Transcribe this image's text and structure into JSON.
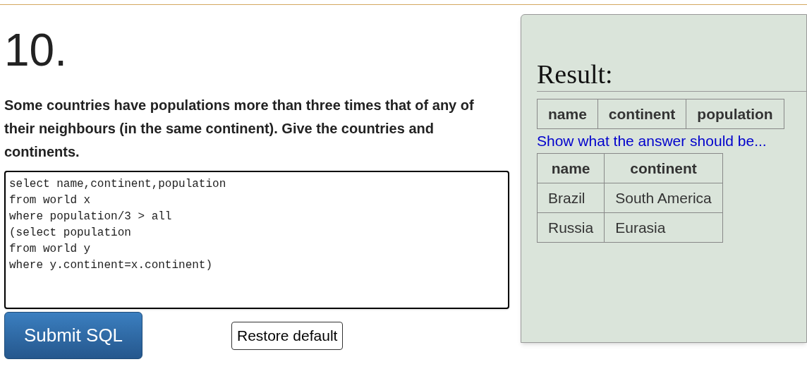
{
  "question": {
    "number": "10.",
    "text": "Some countries have populations more than three times that of any of their neighbours (in the same continent). Give the countries and continents."
  },
  "editor": {
    "value": "select name,continent,population\nfrom world x\nwhere population/3 > all\n(select population\nfrom world y\nwhere y.continent=x.continent)"
  },
  "buttons": {
    "submit": "Submit SQL",
    "restore": "Restore default"
  },
  "result": {
    "title": "Result:",
    "table": {
      "columns": [
        "name",
        "continent",
        "population"
      ]
    },
    "answer_link": "Show what the answer should be...",
    "answer_table": {
      "columns": [
        "name",
        "continent"
      ],
      "rows": [
        [
          "Brazil",
          "South America"
        ],
        [
          "Russia",
          "Eurasia"
        ]
      ]
    }
  }
}
